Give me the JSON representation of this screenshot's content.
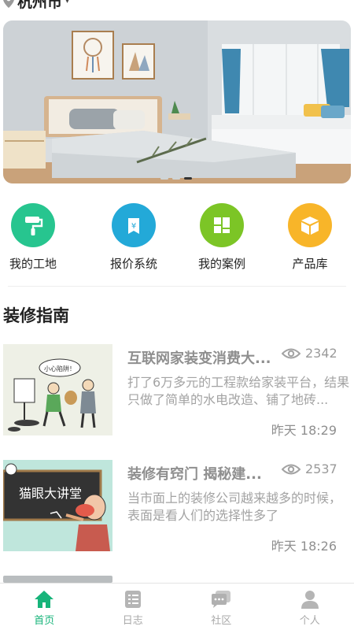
{
  "location": {
    "city": "杭州市",
    "caret": "▾"
  },
  "banner": {
    "dots": 3,
    "active_dot": 2
  },
  "quick_links": [
    {
      "label": "我的工地",
      "icon": "paint-roller-icon",
      "color": "#27c58f"
    },
    {
      "label": "报价系统",
      "icon": "price-tag-icon",
      "color": "#23a9d8"
    },
    {
      "label": "我的案例",
      "icon": "case-tiles-icon",
      "color": "#7cc526"
    },
    {
      "label": "产品库",
      "icon": "product-box-icon",
      "color": "#f8b529"
    }
  ],
  "guide": {
    "title": "装修指南",
    "articles": [
      {
        "title": "互联网家装变消费大...",
        "views": "2342",
        "desc": "打了6万多元的工程款给家装平台，结果只做了简单的水电改造、铺了地砖...",
        "time": "昨天 18:29"
      },
      {
        "title": "装修有窍门 揭秘建...",
        "views": "2537",
        "desc": "当市面上的装修公司越来越多的时候，表面是看人们的选择性多了",
        "time": "昨天 18:26"
      }
    ],
    "cartoon_bubble": "小心陷阱！",
    "cartoon_sign": "猫眼大讲堂"
  },
  "tabs": [
    {
      "label": "首页",
      "icon": "home-icon",
      "active": true
    },
    {
      "label": "日志",
      "icon": "log-icon",
      "active": false
    },
    {
      "label": "社区",
      "icon": "community-icon",
      "active": false
    },
    {
      "label": "个人",
      "icon": "person-icon",
      "active": false
    }
  ]
}
